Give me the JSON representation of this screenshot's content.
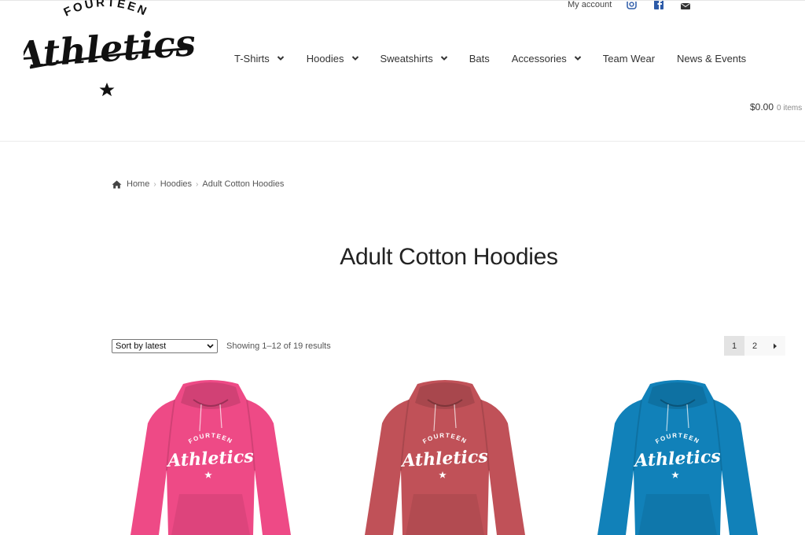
{
  "brand": {
    "arc_text": "FOURTEEN",
    "name": "Athletics"
  },
  "top_links": {
    "account": "My account",
    "social": [
      "instagram-icon",
      "facebook-icon",
      "email-icon"
    ]
  },
  "nav": {
    "items": [
      {
        "label": "T-Shirts",
        "has_dropdown": true
      },
      {
        "label": "Hoodies",
        "has_dropdown": true
      },
      {
        "label": "Sweatshirts",
        "has_dropdown": true
      },
      {
        "label": "Bats",
        "has_dropdown": false
      },
      {
        "label": "Accessories",
        "has_dropdown": true
      },
      {
        "label": "Team Wear",
        "has_dropdown": false
      },
      {
        "label": "News & Events",
        "has_dropdown": false
      }
    ]
  },
  "cart": {
    "total": "$0.00",
    "items": "0 items"
  },
  "breadcrumb": {
    "home": "Home",
    "category": "Hoodies",
    "current": "Adult Cotton Hoodies"
  },
  "page": {
    "title": "Adult Cotton Hoodies"
  },
  "toolbar": {
    "sort_selected": "Sort by latest",
    "results_text": "Showing 1–12 of 19 results"
  },
  "pagination": {
    "pages": [
      "1",
      "2"
    ],
    "current": "1"
  },
  "products": [
    {
      "color": "#ee4a86",
      "print_arc": "FOURTEEN",
      "print_name": "Athletics"
    },
    {
      "color": "#c05158",
      "print_arc": "FOURTEEN",
      "print_name": "Athletics"
    },
    {
      "color": "#1181b9",
      "print_arc": "FOURTEEN",
      "print_name": "Athletics"
    }
  ]
}
